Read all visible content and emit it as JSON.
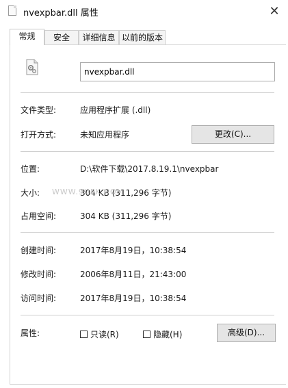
{
  "window": {
    "title": "nvexpbar.dll 属性",
    "close_icon": "close-icon"
  },
  "tabs": [
    {
      "label": "常规",
      "active": true
    },
    {
      "label": "安全",
      "active": false
    },
    {
      "label": "详细信息",
      "active": false
    },
    {
      "label": "以前的版本",
      "active": false
    }
  ],
  "file": {
    "icon": "dll-gear-icon",
    "name": "nvexpbar.dll"
  },
  "type_section": {
    "file_type_label": "文件类型:",
    "file_type_value": "应用程序扩展 (.dll)",
    "opens_with_label": "打开方式:",
    "opens_with_value": "未知应用程序",
    "change_button": "更改(C)..."
  },
  "location_section": {
    "location_label": "位置:",
    "location_value": "D:\\软件下载\\2017.8.19.1\\nvexpbar",
    "size_label": "大小:",
    "size_value": "304 KB (311,296 字节)",
    "size_on_disk_label": "占用空间:",
    "size_on_disk_value": "304 KB (311,296 字节)"
  },
  "watermark": "WWW.9UPK.COM",
  "time_section": {
    "created_label": "创建时间:",
    "created_value": "2017年8月19日，10:38:54",
    "modified_label": "修改时间:",
    "modified_value": "2006年8月11日，21:43:00",
    "accessed_label": "访问时间:",
    "accessed_value": "2017年8月19日，10:38:54"
  },
  "attributes_section": {
    "label": "属性:",
    "readonly_label": "只读(R)",
    "readonly_checked": false,
    "hidden_label": "隐藏(H)",
    "hidden_checked": false,
    "advanced_button": "高级(D)..."
  }
}
